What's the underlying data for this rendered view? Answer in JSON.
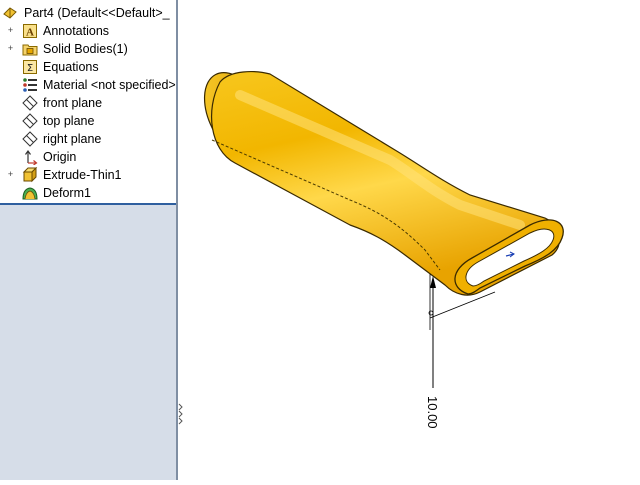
{
  "feature_tree": {
    "root_label": "Part4  (Default<<Default>_",
    "items": [
      {
        "label": "Annotations",
        "icon": "annotations-icon",
        "expandable": true
      },
      {
        "label": "Solid Bodies(1)",
        "icon": "solid-bodies-folder-icon",
        "expandable": true
      },
      {
        "label": "Equations",
        "icon": "equations-icon",
        "expandable": false
      },
      {
        "label": "Material <not specified>",
        "icon": "material-icon",
        "expandable": false
      },
      {
        "label": "front plane",
        "icon": "plane-icon",
        "expandable": false
      },
      {
        "label": "top plane",
        "icon": "plane-icon",
        "expandable": false
      },
      {
        "label": "right plane",
        "icon": "plane-icon",
        "expandable": false
      },
      {
        "label": "Origin",
        "icon": "origin-icon",
        "expandable": false
      },
      {
        "label": "Extrude-Thin1",
        "icon": "extrude-icon",
        "expandable": true
      },
      {
        "label": "Deform1",
        "icon": "deform-icon",
        "expandable": false
      }
    ],
    "expander_symbol": "+"
  },
  "viewport": {
    "dimension_value": "10.00",
    "part_color": "#f5b800"
  }
}
